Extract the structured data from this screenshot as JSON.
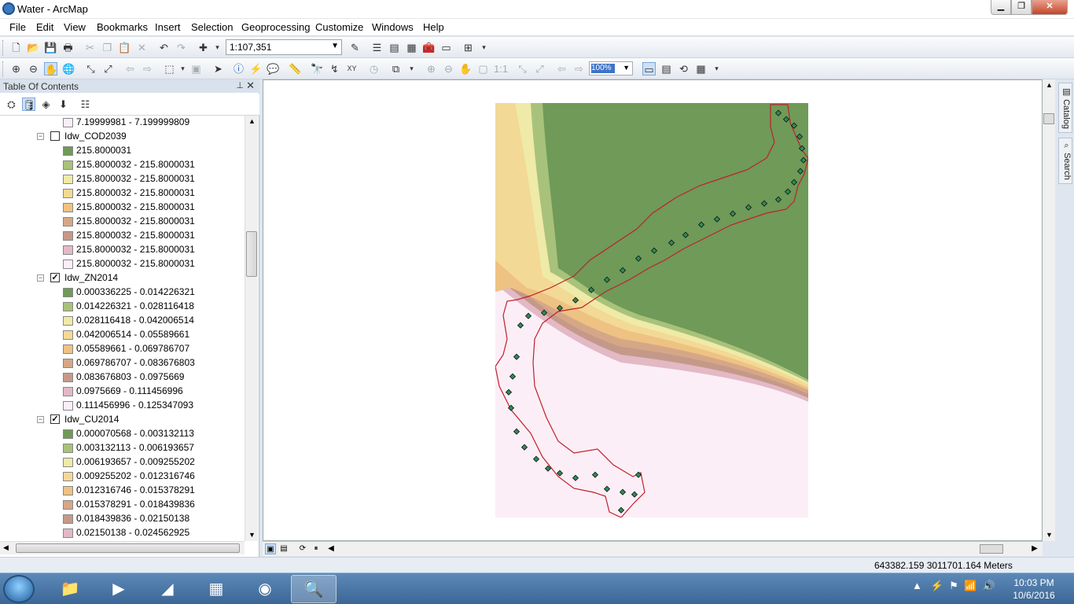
{
  "window": {
    "title": "Water - ArcMap",
    "min": "▁",
    "max": "❐",
    "close": "✕"
  },
  "menu": [
    "File",
    "Edit",
    "View",
    "Bookmarks",
    "Insert",
    "Selection",
    "Geoprocessing",
    "Customize",
    "Windows",
    "Help"
  ],
  "toolbar": {
    "scale": "1:107,351",
    "zoom_percent": "100%"
  },
  "toc": {
    "title": "Table Of Contents",
    "top_class": {
      "label": "7.19999981 - 7.199999809",
      "color": "#fbeef7"
    },
    "layers": [
      {
        "name": "Idw_COD2039",
        "checked": false,
        "classes": [
          {
            "label": "215.8000031",
            "color": "#6f9a58"
          },
          {
            "label": "215.8000032 - 215.8000031",
            "color": "#a8c27b"
          },
          {
            "label": "215.8000032 - 215.8000031",
            "color": "#efeaa7"
          },
          {
            "label": "215.8000032 - 215.8000031",
            "color": "#f3d996"
          },
          {
            "label": "215.8000032 - 215.8000031",
            "color": "#eec282"
          },
          {
            "label": "215.8000032 - 215.8000031",
            "color": "#d6a787"
          },
          {
            "label": "215.8000032 - 215.8000031",
            "color": "#c5998a"
          },
          {
            "label": "215.8000032 - 215.8000031",
            "color": "#e2b9c4"
          },
          {
            "label": "215.8000032 - 215.8000031",
            "color": "#fbeef7"
          }
        ]
      },
      {
        "name": "Idw_ZN2014",
        "checked": true,
        "classes": [
          {
            "label": "0.000336225 - 0.014226321",
            "color": "#6f9a58"
          },
          {
            "label": "0.014226321 - 0.028116418",
            "color": "#a8c27b"
          },
          {
            "label": "0.028116418 - 0.042006514",
            "color": "#efeaa7"
          },
          {
            "label": "0.042006514 - 0.05589661",
            "color": "#f3d996"
          },
          {
            "label": "0.05589661 - 0.069786707",
            "color": "#eec282"
          },
          {
            "label": "0.069786707 - 0.083676803",
            "color": "#d6a787"
          },
          {
            "label": "0.083676803 - 0.0975669",
            "color": "#c5998a"
          },
          {
            "label": "0.0975669 - 0.111456996",
            "color": "#e2b9c4"
          },
          {
            "label": "0.111456996 - 0.125347093",
            "color": "#fbeef7"
          }
        ]
      },
      {
        "name": "Idw_CU2014",
        "checked": true,
        "classes": [
          {
            "label": "0.000070568 - 0.003132113",
            "color": "#6f9a58"
          },
          {
            "label": "0.003132113 - 0.006193657",
            "color": "#a8c27b"
          },
          {
            "label": "0.006193657 - 0.009255202",
            "color": "#efeaa7"
          },
          {
            "label": "0.009255202 - 0.012316746",
            "color": "#f3d996"
          },
          {
            "label": "0.012316746 - 0.015378291",
            "color": "#eec282"
          },
          {
            "label": "0.015378291 - 0.018439836",
            "color": "#d6a787"
          },
          {
            "label": "0.018439836 - 0.02150138",
            "color": "#c5998a"
          },
          {
            "label": "0.02150138 - 0.024562925",
            "color": "#e2b9c4"
          }
        ]
      }
    ]
  },
  "dock": {
    "catalog": "Catalog",
    "search": "Search"
  },
  "status": {
    "coords": "643382.159  3011701.164 Meters"
  },
  "clock": {
    "time": "10:03 PM",
    "date": "10/6/2016"
  },
  "map_colors": {
    "green": "#6f9a58",
    "boundary": "#c0202a",
    "point": "#2e8b57"
  }
}
